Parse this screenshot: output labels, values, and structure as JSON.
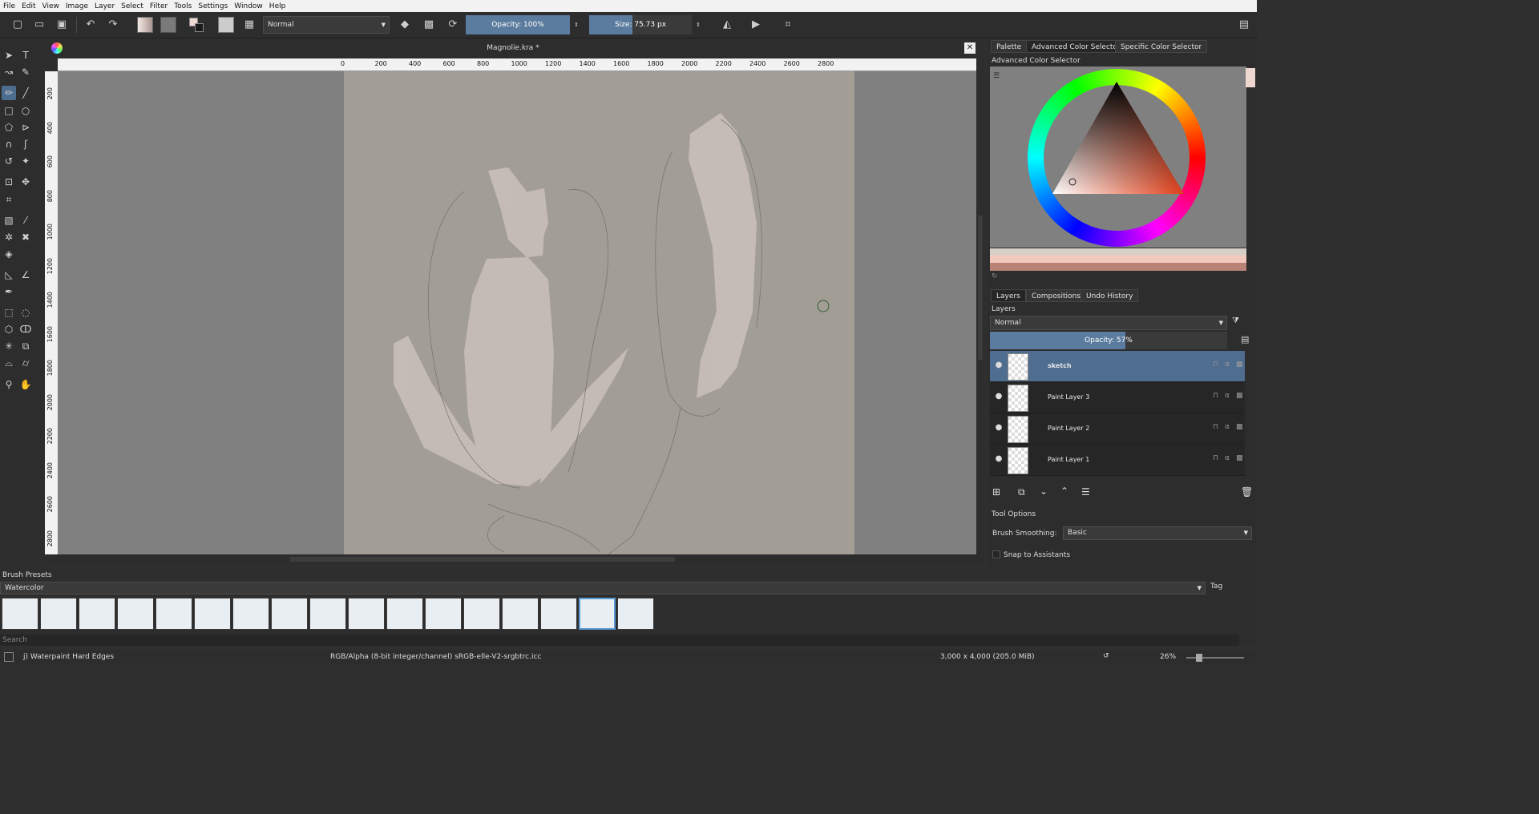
{
  "menubar": [
    "File",
    "Edit",
    "View",
    "Image",
    "Layer",
    "Select",
    "Filter",
    "Tools",
    "Settings",
    "Window",
    "Help"
  ],
  "toolbar": {
    "blend_mode": "Normal",
    "opacity": "Opacity: 100%",
    "opacity_level": 1.0,
    "size_label": "Size:",
    "size_value": "75.73 px"
  },
  "document": {
    "title": "Magnolie.kra *",
    "hruler_ticks": [
      "0",
      "200",
      "400",
      "600",
      "800",
      "1000",
      "1200",
      "1400",
      "1600",
      "1800",
      "2000",
      "2200",
      "2400",
      "2600",
      "2800"
    ],
    "vruler_ticks": [
      "200",
      "400",
      "600",
      "800",
      "1000",
      "1200",
      "1400",
      "1600",
      "1800",
      "2000",
      "2200",
      "2400",
      "2600",
      "2800"
    ]
  },
  "dock": {
    "top_tabs": [
      "Palette",
      "Advanced Color Selector",
      "Specific Color Selector"
    ],
    "color_selector_title": "Advanced Color Selector",
    "layer_tabs": [
      "Layers",
      "Compositions",
      "Undo History"
    ],
    "layers_title": "Layers",
    "layer_blend": "Normal",
    "layer_opacity": "Opacity:  57%",
    "layer_opacity_level": 0.57,
    "layers": [
      {
        "name": "sketch",
        "selected": true
      },
      {
        "name": "Paint Layer 3",
        "selected": false
      },
      {
        "name": "Paint Layer 2",
        "selected": false
      },
      {
        "name": "Paint Layer 1",
        "selected": false
      }
    ],
    "tool_options_title": "Tool Options",
    "brush_smoothing_label": "Brush Smoothing:",
    "brush_smoothing_value": "Basic",
    "snap_label": "Snap to Assistants"
  },
  "presets": {
    "title": "Brush Presets",
    "category": "Watercolor",
    "tag_label": "Tag",
    "search_placeholder": "Search"
  },
  "status": {
    "brush": "j) Waterpaint Hard Edges",
    "color_profile": "RGB/Alpha (8-bit integer/channel)  sRGB-elle-V2-srgbtrc.icc",
    "image_size": "3,000 x 4,000 (205.0 MiB)",
    "zoom": "26%"
  },
  "colors": {
    "accent": "#5b7c9e",
    "paper": "#a39e95",
    "canvas_bg": "#808080"
  }
}
